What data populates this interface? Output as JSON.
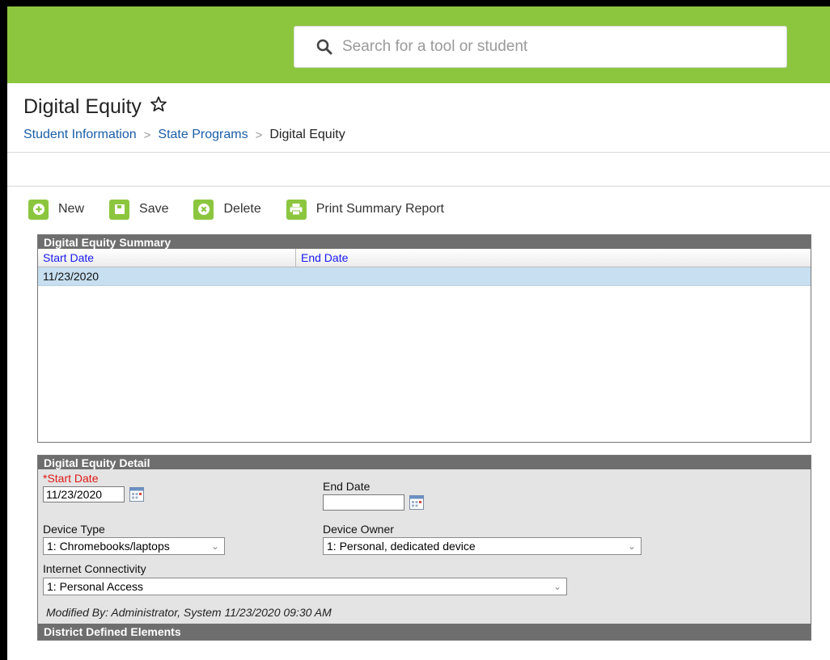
{
  "search": {
    "placeholder": "Search for a tool or student"
  },
  "page": {
    "title": "Digital Equity",
    "breadcrumb": [
      "Student Information",
      "State Programs",
      "Digital Equity"
    ]
  },
  "toolbar": {
    "new_label": "New",
    "save_label": "Save",
    "delete_label": "Delete",
    "print_label": "Print Summary Report"
  },
  "summary": {
    "title": "Digital Equity Summary",
    "columns": [
      "Start Date",
      "End Date"
    ],
    "rows": [
      {
        "start": "11/23/2020",
        "end": ""
      }
    ]
  },
  "detail": {
    "title": "Digital Equity Detail",
    "start_date_req": "*",
    "start_date_label": "Start Date",
    "start_date_value": "11/23/2020",
    "end_date_label": "End Date",
    "end_date_value": "",
    "device_type_label": "Device Type",
    "device_type_value": "1: Chromebooks/laptops",
    "device_owner_label": "Device Owner",
    "device_owner_value": "1: Personal, dedicated device",
    "internet_label": "Internet Connectivity",
    "internet_value": "1: Personal Access",
    "modified": "Modified By: Administrator, System 11/23/2020 09:30 AM",
    "district_title": "District Defined Elements"
  },
  "colors": {
    "brand_green": "#8cc63f",
    "panel_header": "#6e6e6e",
    "link_blue": "#1a5ea8",
    "selected_row": "#c7dff0",
    "required_red": "#e01818"
  },
  "icons": {
    "search": "search-icon",
    "favorite": "star-outline-icon",
    "new": "plus-circle-icon",
    "save": "floppy-icon",
    "delete": "x-circle-icon",
    "print": "printer-icon",
    "calendar": "calendar-icon",
    "dropdown": "chevron-down-icon"
  }
}
